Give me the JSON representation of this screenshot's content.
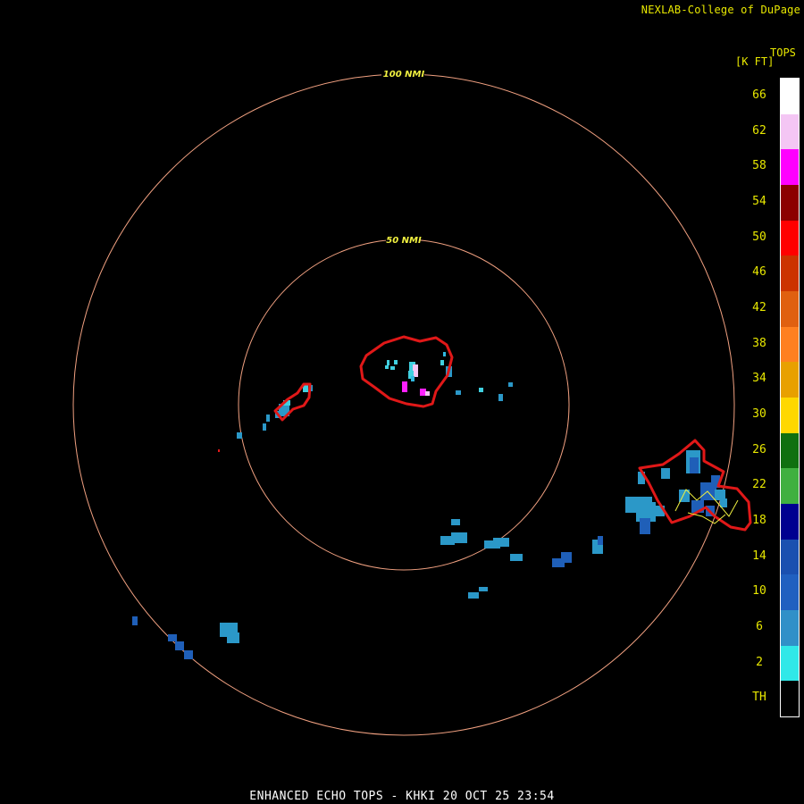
{
  "credit": "NEXLAB-College of DuPage",
  "legend": {
    "title": "TOPS",
    "unit": "[K FT]",
    "levels": [
      {
        "label": "66",
        "color": "#ffffff"
      },
      {
        "label": "62",
        "color": "#f4c6f4"
      },
      {
        "label": "58",
        "color": "#ff00ff"
      },
      {
        "label": "54",
        "color": "#8c0000"
      },
      {
        "label": "50",
        "color": "#ff0000"
      },
      {
        "label": "46",
        "color": "#cc3300"
      },
      {
        "label": "42",
        "color": "#e06010"
      },
      {
        "label": "38",
        "color": "#ff8020"
      },
      {
        "label": "34",
        "color": "#e8a000"
      },
      {
        "label": "30",
        "color": "#ffd800"
      },
      {
        "label": "26",
        "color": "#107010"
      },
      {
        "label": "22",
        "color": "#40b040"
      },
      {
        "label": "18",
        "color": "#000090"
      },
      {
        "label": "14",
        "color": "#1a50b0"
      },
      {
        "label": "10",
        "color": "#2060c0"
      },
      {
        "label": "6",
        "color": "#3090c8"
      },
      {
        "label": "2",
        "color": "#30e8e8"
      },
      {
        "label": "TH",
        "color": "#000000"
      }
    ]
  },
  "range_rings": [
    {
      "label": "100 NMI"
    },
    {
      "label": "50 NMI"
    }
  ],
  "footer": "ENHANCED ECHO TOPS - KHKI 20 OCT 25 23:54",
  "colors": {
    "ring": "#f0a080",
    "warning": "#e01818",
    "cyan": "#40d0e0",
    "blue": "#2b98c8",
    "dark_blue": "#1f5fb8",
    "magenta": "#ff20ff"
  }
}
